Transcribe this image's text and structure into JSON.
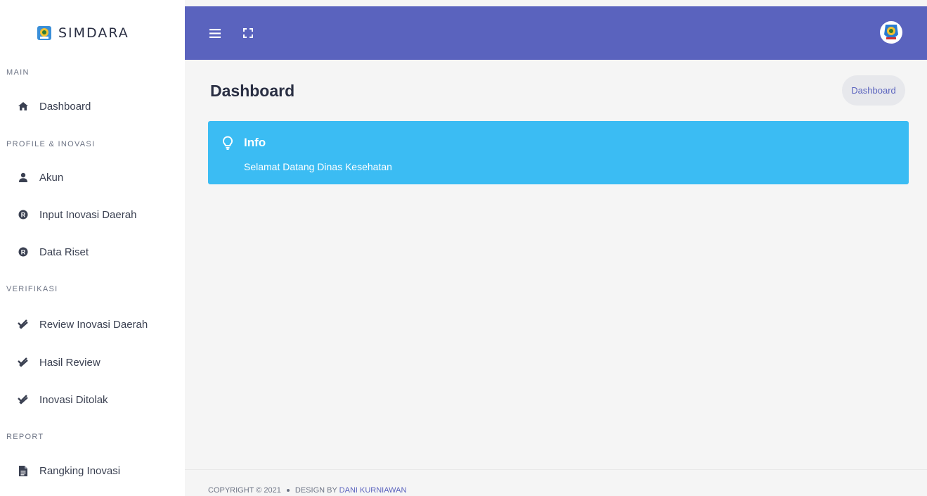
{
  "app": {
    "brand": "SIMDARA"
  },
  "colors": {
    "accent": "#5a63be",
    "info": "#3bbcf3",
    "sidebar_bg": "#ffffff",
    "page_bg": "#f5f5f5"
  },
  "sidebar": {
    "sections": [
      {
        "title": "MAIN",
        "items": [
          {
            "label": "Dashboard",
            "icon": "home-icon"
          }
        ]
      },
      {
        "title": "PROFILE & INOVASI",
        "items": [
          {
            "label": "Akun",
            "icon": "user-icon"
          },
          {
            "label": "Input Inovasi Daerah",
            "icon": "registered-icon"
          },
          {
            "label": "Data Riset",
            "icon": "registered-icon"
          }
        ]
      },
      {
        "title": "VERIFIKASI",
        "items": [
          {
            "label": "Review Inovasi Daerah",
            "icon": "double-check-icon"
          },
          {
            "label": "Hasil Review",
            "icon": "double-check-icon"
          },
          {
            "label": "Inovasi Ditolak",
            "icon": "double-check-icon"
          }
        ]
      },
      {
        "title": "REPORT",
        "items": [
          {
            "label": "Rangking Inovasi",
            "icon": "file-icon"
          }
        ]
      }
    ]
  },
  "topbar": {
    "menu_icon": "hamburger-icon",
    "fullscreen_icon": "fullscreen-icon",
    "avatar_icon": "emblem-avatar"
  },
  "main": {
    "title": "Dashboard",
    "breadcrumb": "Dashboard",
    "alert": {
      "icon": "lightbulb-icon",
      "title": "Info",
      "text": "Selamat Datang Dinas Kesehatan"
    }
  },
  "footer": {
    "copyright": "COPYRIGHT © 2021",
    "design_by": "DESIGN BY",
    "author": "DANI KURNIAWAN"
  }
}
